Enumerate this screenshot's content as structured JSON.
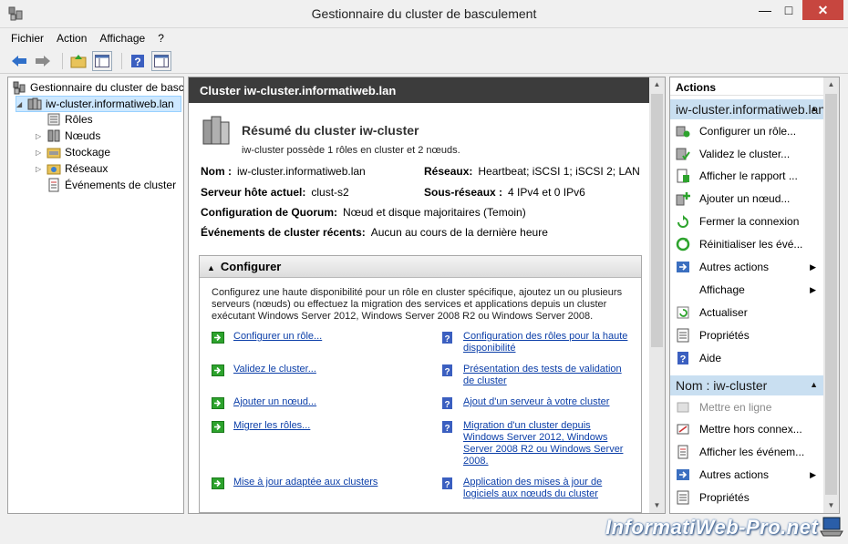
{
  "window": {
    "title": "Gestionnaire du cluster de basculement",
    "minimize": "—",
    "maximize": "□",
    "close": "✕"
  },
  "menu": [
    "Fichier",
    "Action",
    "Affichage",
    "?"
  ],
  "toolbar_icons": [
    "back-icon",
    "forward-icon",
    "up-folder-icon",
    "show-hide-console-tree-icon",
    "help-icon",
    "show-hide-action-pane-icon"
  ],
  "tree": {
    "root": "Gestionnaire du cluster de basculement",
    "cluster": "iw-cluster.informatiweb.lan",
    "children": [
      "Rôles",
      "Nœuds",
      "Stockage",
      "Réseaux",
      "Événements de cluster"
    ]
  },
  "center": {
    "header": "Cluster iw-cluster.informatiweb.lan",
    "summary_title": "Résumé du cluster iw-cluster",
    "summary_desc": "iw-cluster possède 1 rôles en cluster et 2 nœuds.",
    "fields": {
      "nom_label": "Nom :",
      "nom_value": "iw-cluster.informatiweb.lan",
      "reseaux_label": "Réseaux:",
      "reseaux_value": "Heartbeat; iSCSI 1; iSCSI 2; LAN",
      "serveur_label": "Serveur hôte actuel:",
      "serveur_value": "clust-s2",
      "sousreseaux_label": "Sous-réseaux :",
      "sousreseaux_value": "4 IPv4 et 0 IPv6",
      "quorum_label": "Configuration de Quorum:",
      "quorum_value": "Nœud et disque majoritaires (Temoin)",
      "events_label": "Événements de cluster récents:",
      "events_value": "Aucun au cours de la dernière heure"
    },
    "configurer": {
      "title": "Configurer",
      "desc": "Configurez une haute disponibilité pour un rôle en cluster spécifique, ajoutez un ou plusieurs serveurs (nœuds) ou effectuez la migration des services et applications depuis un cluster exécutant Windows Server 2012, Windows Server 2008 R2 ou Windows Server 2008.",
      "tasks_left": [
        "Configurer un rôle...",
        "Validez le cluster...",
        "Ajouter un nœud...",
        "Migrer les rôles...",
        "Mise à jour adaptée aux clusters"
      ],
      "tasks_right": [
        "Configuration des rôles pour la haute disponibilité",
        "Présentation des tests de validation de cluster",
        "Ajout d'un serveur à votre cluster",
        "Migration d'un cluster depuis Windows Server 2012, Windows Server 2008 R2 ou Windows Server 2008.",
        "Application des mises à jour de logiciels aux nœuds du cluster"
      ]
    }
  },
  "actions": {
    "header": "Actions",
    "group1": "iw-cluster.informatiweb.lan",
    "group1_items": [
      "Configurer un rôle...",
      "Validez le cluster...",
      "Afficher le rapport ...",
      "Ajouter un nœud...",
      "Fermer la connexion",
      "Réinitialiser les évé...",
      "Autres actions",
      "Affichage",
      "Actualiser",
      "Propriétés",
      "Aide"
    ],
    "group2": "Nom : iw-cluster",
    "group2_items": [
      "Mettre en ligne",
      "Mettre hors connex...",
      "Afficher les événem...",
      "Autres actions",
      "Propriétés"
    ]
  },
  "watermark": "InformatiWeb-Pro.net",
  "colors": {
    "header_dark": "#3c3c3c",
    "link": "#0b3ea8",
    "action_group_bg": "#c9dff1",
    "green_arrow": "#2da32d",
    "help_blue": "#3b5fc0"
  }
}
